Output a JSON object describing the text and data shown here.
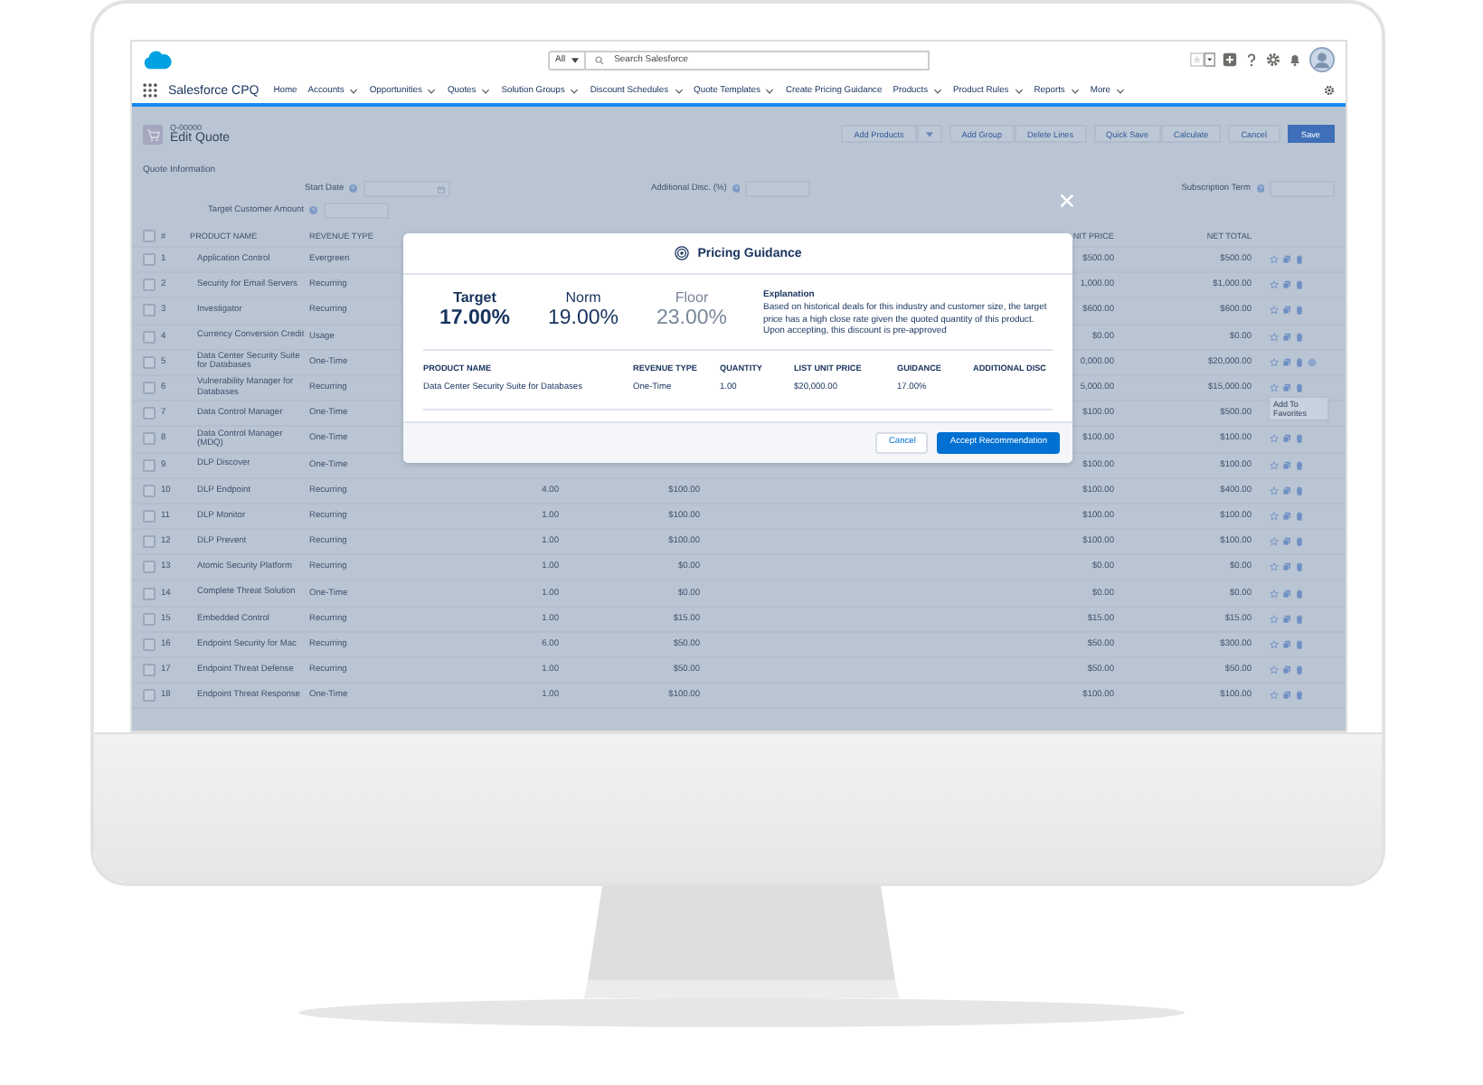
{
  "header": {
    "scope": "All",
    "search_placeholder": "Search Salesforce"
  },
  "nav": {
    "app_name": "Salesforce CPQ",
    "items": [
      {
        "label": "Home",
        "dropdown": false
      },
      {
        "label": "Accounts",
        "dropdown": true
      },
      {
        "label": "Opportunities",
        "dropdown": true
      },
      {
        "label": "Quotes",
        "dropdown": true
      },
      {
        "label": "Solution Groups",
        "dropdown": true
      },
      {
        "label": "Discount Schedules",
        "dropdown": true
      },
      {
        "label": "Quote Templates",
        "dropdown": true
      },
      {
        "label": "Create Pricing Guidance",
        "dropdown": false
      },
      {
        "label": "Products",
        "dropdown": true
      },
      {
        "label": "Product Rules",
        "dropdown": true
      },
      {
        "label": "Reports",
        "dropdown": true
      },
      {
        "label": "More",
        "dropdown": true
      }
    ]
  },
  "page": {
    "record_id": "Q-00000",
    "title": "Edit Quote",
    "button_groups": [
      [
        {
          "label": "Add Products",
          "kind": "neutral"
        },
        {
          "kind": "menu"
        }
      ],
      [
        {
          "label": "Add Group",
          "kind": "neutral"
        },
        {
          "label": "Delete Lines",
          "kind": "neutral"
        }
      ],
      [
        {
          "label": "Quick Save",
          "kind": "neutral"
        },
        {
          "label": "Calculate",
          "kind": "neutral"
        }
      ],
      [
        {
          "label": "Cancel",
          "kind": "neutral"
        }
      ],
      [
        {
          "label": "Save",
          "kind": "brand"
        }
      ]
    ],
    "section_title": "Quote Information",
    "fields": [
      {
        "label": "Start Date",
        "kind": "date"
      },
      {
        "label": "Additional Disc. (%)",
        "kind": "text"
      },
      {
        "label": "Subscription Term",
        "kind": "text"
      },
      {
        "label": "Target Customer Amount",
        "kind": "text"
      }
    ],
    "table": {
      "checked": false,
      "columns": {
        "number": "#",
        "product": "PRODUCT NAME",
        "revenue_type": "REVENUE TYPE",
        "unit_price": "NIT PRICE",
        "net_total": "NET TOTAL"
      },
      "rows": [
        {
          "checked": false,
          "number": "1",
          "product": "Application Control",
          "revenue_type": "Evergreen",
          "unit_price": "$500.00",
          "net_total": "$500.00",
          "info_icon": false
        },
        {
          "checked": false,
          "number": "2",
          "product": "Security for Email Servers",
          "revenue_type": "Recurring",
          "unit_price": "1,000.00",
          "net_total": "$1,000.00",
          "info_icon": false
        },
        {
          "checked": false,
          "number": "3",
          "product": "Investigator",
          "revenue_type": "Recurring",
          "unit_price": "$600.00",
          "net_total": "$600.00",
          "info_icon": false
        },
        {
          "checked": false,
          "number": "4",
          "product": "Currency Conversion Credit",
          "revenue_type": "Usage",
          "unit_price": "$0.00",
          "net_total": "$0.00",
          "info_icon": false
        },
        {
          "checked": false,
          "number": "5",
          "product": "Data Center Security Suite for Databases",
          "revenue_type": "One-Time",
          "unit_price": "0,000.00",
          "net_total": "$20,000.00",
          "info_icon": true
        },
        {
          "checked": false,
          "number": "6",
          "product": "Vulnerability Manager for Databases",
          "revenue_type": "Recurring",
          "unit_price": "5,000.00",
          "net_total": "$15,000.00",
          "info_icon": false,
          "tooltip": "Add To Favorites"
        },
        {
          "checked": false,
          "number": "7",
          "product": "Data Control Manager",
          "revenue_type": "One-Time",
          "unit_price": "$100.00",
          "net_total": "$500.00",
          "info_icon": false
        },
        {
          "checked": false,
          "number": "8",
          "product": "Data Control Manager (MDQ)",
          "revenue_type": "One-Time",
          "unit_price": "$100.00",
          "net_total": "$100.00",
          "info_icon": false
        },
        {
          "checked": false,
          "number": "9",
          "product": "DLP Discover",
          "revenue_type": "One-Time",
          "unit_price": "$100.00",
          "net_total": "$100.00",
          "info_icon": false
        },
        {
          "checked": false,
          "number": "10",
          "product": "DLP Endpoint",
          "revenue_type": "Recurring",
          "quantity": "4.00",
          "list_price": "$100.00",
          "unit_price": "$100.00",
          "net_total": "$400.00",
          "info_icon": false
        },
        {
          "checked": false,
          "number": "11",
          "product": "DLP Monitor",
          "revenue_type": "Recurring",
          "quantity": "1.00",
          "list_price": "$100.00",
          "unit_price": "$100.00",
          "net_total": "$100.00",
          "info_icon": false
        },
        {
          "checked": false,
          "number": "12",
          "product": "DLP Prevent",
          "revenue_type": "Recurring",
          "quantity": "1.00",
          "list_price": "$100.00",
          "unit_price": "$100.00",
          "net_total": "$100.00",
          "info_icon": false
        },
        {
          "checked": false,
          "number": "13",
          "product": "Atomic Security Platform",
          "revenue_type": "Recurring",
          "quantity": "1.00",
          "list_price": "$0.00",
          "unit_price": "$0.00",
          "net_total": "$0.00",
          "info_icon": false
        },
        {
          "checked": false,
          "number": "14",
          "product": "Complete Threat Solution",
          "revenue_type": "One-Time",
          "quantity": "1.00",
          "list_price": "$0.00",
          "unit_price": "$0.00",
          "net_total": "$0.00",
          "info_icon": false
        },
        {
          "checked": false,
          "number": "15",
          "product": "Embedded Control",
          "revenue_type": "Recurring",
          "quantity": "1.00",
          "list_price": "$15.00",
          "unit_price": "$15.00",
          "net_total": "$15.00",
          "info_icon": false
        },
        {
          "checked": false,
          "number": "16",
          "product": "Endpoint Security for Mac",
          "revenue_type": "Recurring",
          "quantity": "6.00",
          "list_price": "$50.00",
          "unit_price": "$50.00",
          "net_total": "$300.00",
          "info_icon": false
        },
        {
          "checked": false,
          "number": "17",
          "product": "Endpoint Threat Defense",
          "revenue_type": "Recurring",
          "quantity": "1.00",
          "list_price": "$50.00",
          "unit_price": "$50.00",
          "net_total": "$50.00",
          "info_icon": false
        },
        {
          "checked": false,
          "number": "18",
          "product": "Endpoint Threat Response",
          "revenue_type": "One-Time",
          "quantity": "1.00",
          "list_price": "$100.00",
          "unit_price": "$100.00",
          "net_total": "$100.00",
          "info_icon": false
        }
      ]
    }
  },
  "modal": {
    "title": "Pricing Guidance",
    "metrics": [
      {
        "label": "Target",
        "value": "17.00%",
        "kind": "strong"
      },
      {
        "label": "Norm",
        "value": "19.00%",
        "kind": "normal"
      },
      {
        "label": "Floor",
        "value": "23.00%",
        "kind": "muted"
      }
    ],
    "explanation": {
      "heading": "Explanation",
      "text": "Based on historical deals for this industry and customer size, the target price has a high close rate given the quoted quantity of this product. Upon accepting, this discount is pre-approved"
    },
    "table": {
      "columns": [
        "PRODUCT NAME",
        "REVENUE TYPE",
        "QUANTITY",
        "LIST UNIT PRICE",
        "GUIDANCE",
        "ADDITIONAL DISC"
      ],
      "rows": [
        [
          "Data Center Security Suite for Databases",
          "One-Time",
          "1.00",
          "$20,000.00",
          "17.00%"
        ]
      ]
    },
    "buttons": [
      {
        "label": "Cancel",
        "kind": "neutral"
      },
      {
        "label": "Accept Recommendation",
        "kind": "brand"
      }
    ]
  }
}
